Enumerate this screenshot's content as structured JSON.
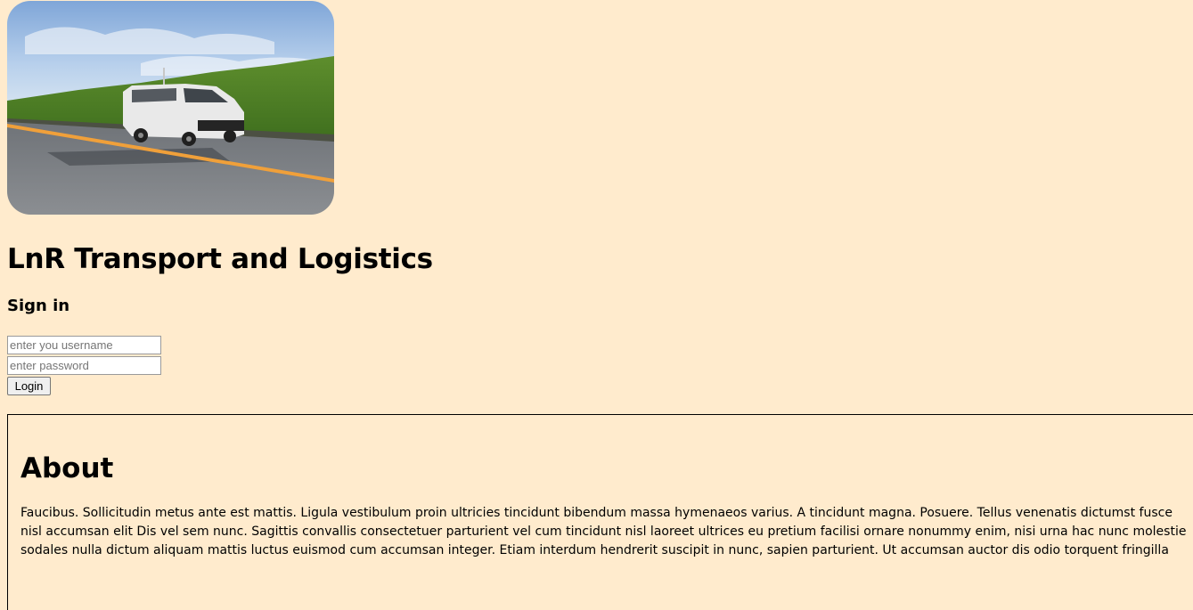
{
  "page": {
    "background_color": "#ffebcd"
  },
  "hero_image": {
    "icon": "van-photo"
  },
  "header": {
    "title": "LnR Transport and Logistics"
  },
  "sign_in": {
    "heading": "Sign in",
    "username_placeholder": "enter you username",
    "username_value": "",
    "password_placeholder": "enter password",
    "password_value": "",
    "login_label": "Login"
  },
  "about": {
    "title": "About",
    "text": "Faucibus. Sollicitudin metus ante est mattis. Ligula vestibulum proin ultricies tincidunt bibendum massa hymenaeos varius. A tincidunt magna. Posuere. Tellus venenatis dictumst fusce nisl accumsan elit Dis vel sem nunc. Sagittis convallis consectetuer parturient vel cum tincidunt nisl laoreet ultrices eu pretium facilisi ornare nonummy enim, nisi urna hac nunc molestie sodales nulla dictum aliquam mattis luctus euismod cum accumsan integer. Etiam interdum hendrerit suscipit in nunc, sapien parturient. Ut accumsan auctor dis odio torquent fringilla"
  }
}
